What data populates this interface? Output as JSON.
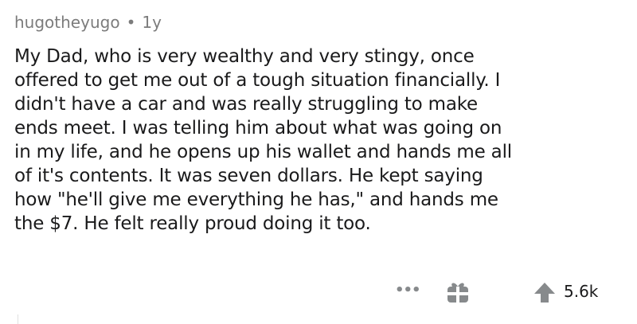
{
  "comment": {
    "author": "hugotheyugo",
    "separator": "•",
    "age": "1y",
    "lines": [
      "My Dad, who is very wealthy and very stingy, once",
      "offered to get me out of a tough situation financially.  I",
      "didn't have a car and was really struggling to make",
      "ends meet.  I was telling him about what was going on",
      "in my life, and he opens up his wallet and hands me all",
      "of it's contents.  It was seven dollars.  He kept saying",
      "how \"he'll give me everything he has,\" and hands me",
      "the $7.  He felt really proud doing it too."
    ],
    "actions": {
      "more": "•••",
      "award_icon": "gift-icon",
      "upvote_icon": "upvote-arrow-icon",
      "score": "5.6k"
    }
  }
}
